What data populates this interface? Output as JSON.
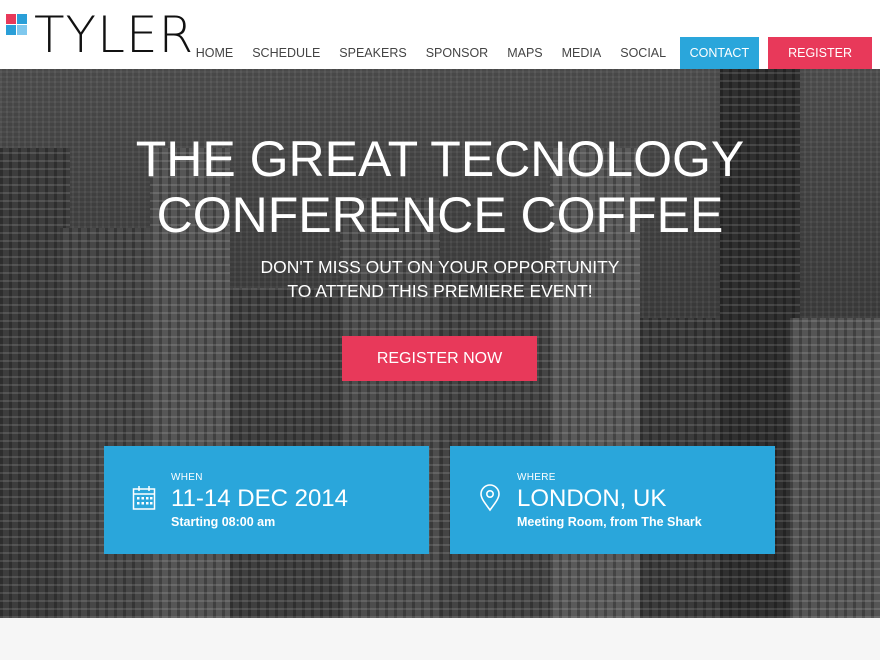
{
  "brand": {
    "logo_text": "TYLER"
  },
  "nav": {
    "items": [
      "HOME",
      "SCHEDULE",
      "SPEAKERS",
      "SPONSOR",
      "MAPS",
      "MEDIA",
      "SOCIAL"
    ],
    "contact_label": "CONTACT",
    "register_label": "REGISTER"
  },
  "hero": {
    "title_line1": "THE GREAT TECNOLOGY",
    "title_line2": "CONFERENCE COFFEE",
    "subtitle_line1": "DON'T MISS OUT ON YOUR OPPORTUNITY",
    "subtitle_line2": "TO ATTEND THIS PREMIERE EVENT!",
    "cta_label": "REGISTER NOW"
  },
  "when": {
    "label": "WHEN",
    "value": "11-14 DEC 2014",
    "detail": "Starting 08:00 am",
    "icon": "calendar-icon"
  },
  "where": {
    "label": "WHERE",
    "value": "LONDON, UK",
    "detail": "Meeting Room, from The Shark",
    "icon": "map-pin-icon"
  },
  "colors": {
    "accent_blue": "#2aa6db",
    "accent_red": "#e8395a"
  }
}
